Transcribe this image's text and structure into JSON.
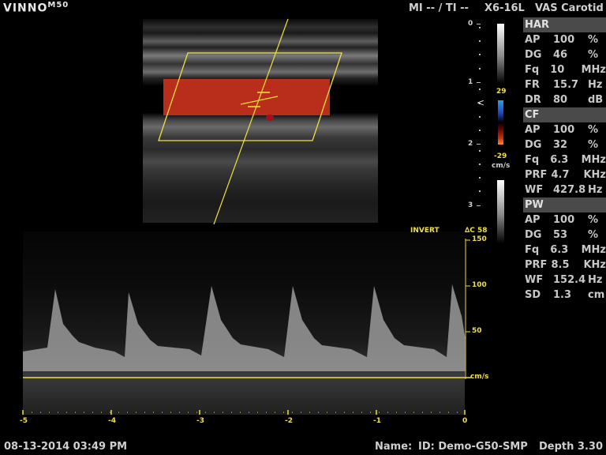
{
  "header": {
    "brand": "VINNO",
    "model": "M50",
    "mi_ti": "MI -- / TI --",
    "probe": "X6-16L",
    "preset": "VAS Carotid"
  },
  "depth_scale": {
    "labels": [
      "0",
      "1",
      "2",
      "3"
    ]
  },
  "color_scale": {
    "top": "29",
    "bottom": "-29",
    "unit": "cm/s"
  },
  "params": {
    "har": {
      "title": "HAR",
      "rows": [
        {
          "k": "AP",
          "v": "100",
          "u": "%"
        },
        {
          "k": "DG",
          "v": "46",
          "u": "%"
        },
        {
          "k": "Fq",
          "v": "10",
          "u": "MHz"
        },
        {
          "k": "FR",
          "v": "15.7",
          "u": "Hz"
        },
        {
          "k": "DR",
          "v": "80",
          "u": "dB"
        }
      ]
    },
    "cf": {
      "title": "CF",
      "rows": [
        {
          "k": "AP",
          "v": "100",
          "u": "%"
        },
        {
          "k": "DG",
          "v": "32",
          "u": "%"
        },
        {
          "k": "Fq",
          "v": "6.3",
          "u": "MHz"
        },
        {
          "k": "PRF",
          "v": "4.7",
          "u": "KHz"
        },
        {
          "k": "WF",
          "v": "427.8",
          "u": "Hz"
        }
      ]
    },
    "pw": {
      "title": "PW",
      "rows": [
        {
          "k": "AP",
          "v": "100",
          "u": "%"
        },
        {
          "k": "DG",
          "v": "53",
          "u": "%"
        },
        {
          "k": "Fq",
          "v": "6.3",
          "u": "MHz"
        },
        {
          "k": "PRF",
          "v": "8.5",
          "u": "KHz"
        },
        {
          "k": "WF",
          "v": "152.4",
          "u": "Hz"
        },
        {
          "k": "SD",
          "v": "1.3",
          "u": "cm"
        }
      ]
    }
  },
  "spectral": {
    "invert_label": "INVERT",
    "angle_label": "∆C 58",
    "velocity_labels": [
      "150",
      "100",
      "50"
    ],
    "velocity_unit": "cm/s",
    "time_labels": [
      "-5",
      "-4",
      "-3",
      "-2",
      "-1",
      "0"
    ]
  },
  "footer": {
    "datetime": "08-13-2014 03:49 PM",
    "name_label": "Name:",
    "id": "ID: Demo-G50-SMP",
    "depth": "Depth 3.30"
  },
  "colors": {
    "accent": "#f0e040",
    "flow": "#c8321c",
    "section_bg": "#4a4a4a"
  }
}
